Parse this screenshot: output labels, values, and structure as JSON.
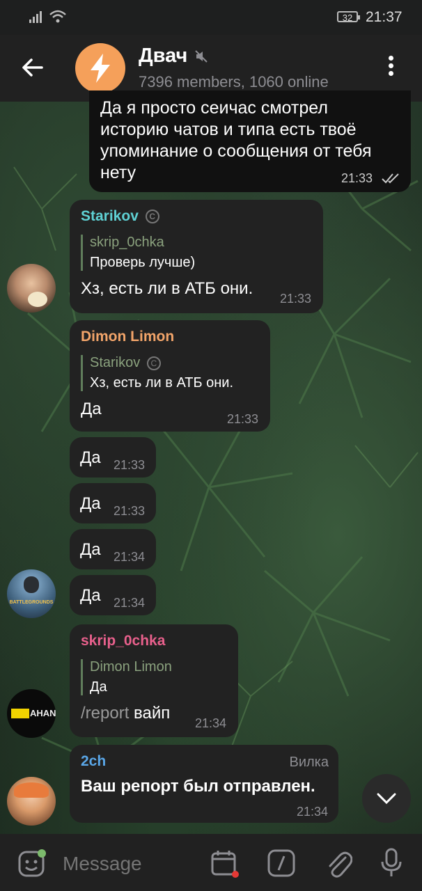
{
  "status": {
    "battery": "32",
    "time": "21:37"
  },
  "header": {
    "title": "Двач",
    "subtitle": "7396 members, 1060 online"
  },
  "messages": [
    {
      "type": "outgoing",
      "lines": [
        "Да я просто сеичас смотрел",
        "историю чатов и типа есть твоё",
        "упоминание о сообщения от тебя",
        "нету"
      ],
      "time": "21:33"
    },
    {
      "sender": "Starikov",
      "sender_color": "#5fd1d4",
      "reply_name": "skrip_0chka",
      "reply_text": "Проверь лучше)",
      "text": "Хз, есть ли в АТБ они.",
      "time": "21:33"
    },
    {
      "sender": "Dimon Limon",
      "sender_color": "#f3a56a",
      "reply_name": "Starikov",
      "reply_text": "Хз, есть ли в АТБ они.",
      "text": "Да",
      "time": "21:33"
    },
    {
      "text": "Да",
      "time": "21:33"
    },
    {
      "text": "Да",
      "time": "21:33"
    },
    {
      "text": "Да",
      "time": "21:34"
    },
    {
      "text": "Да",
      "time": "21:34"
    },
    {
      "sender": "skrip_0chka",
      "sender_color": "#e8608c",
      "reply_name": "Dimon Limon",
      "reply_text": "Да",
      "command": "/report",
      "text": "вайп",
      "time": "21:34"
    },
    {
      "sender": "2ch",
      "sender_color": "#5aa7e8",
      "badge": "Вилка",
      "text": "Ваш репорт был отправлен.",
      "time": "21:34"
    }
  ],
  "avatars": {
    "pubg_text": "BATTLEGROUNDS",
    "ahan_text": "AHAN"
  },
  "input": {
    "placeholder": "Message"
  },
  "colors": {
    "accent": "#f5a05a",
    "bubble": "#222222"
  }
}
